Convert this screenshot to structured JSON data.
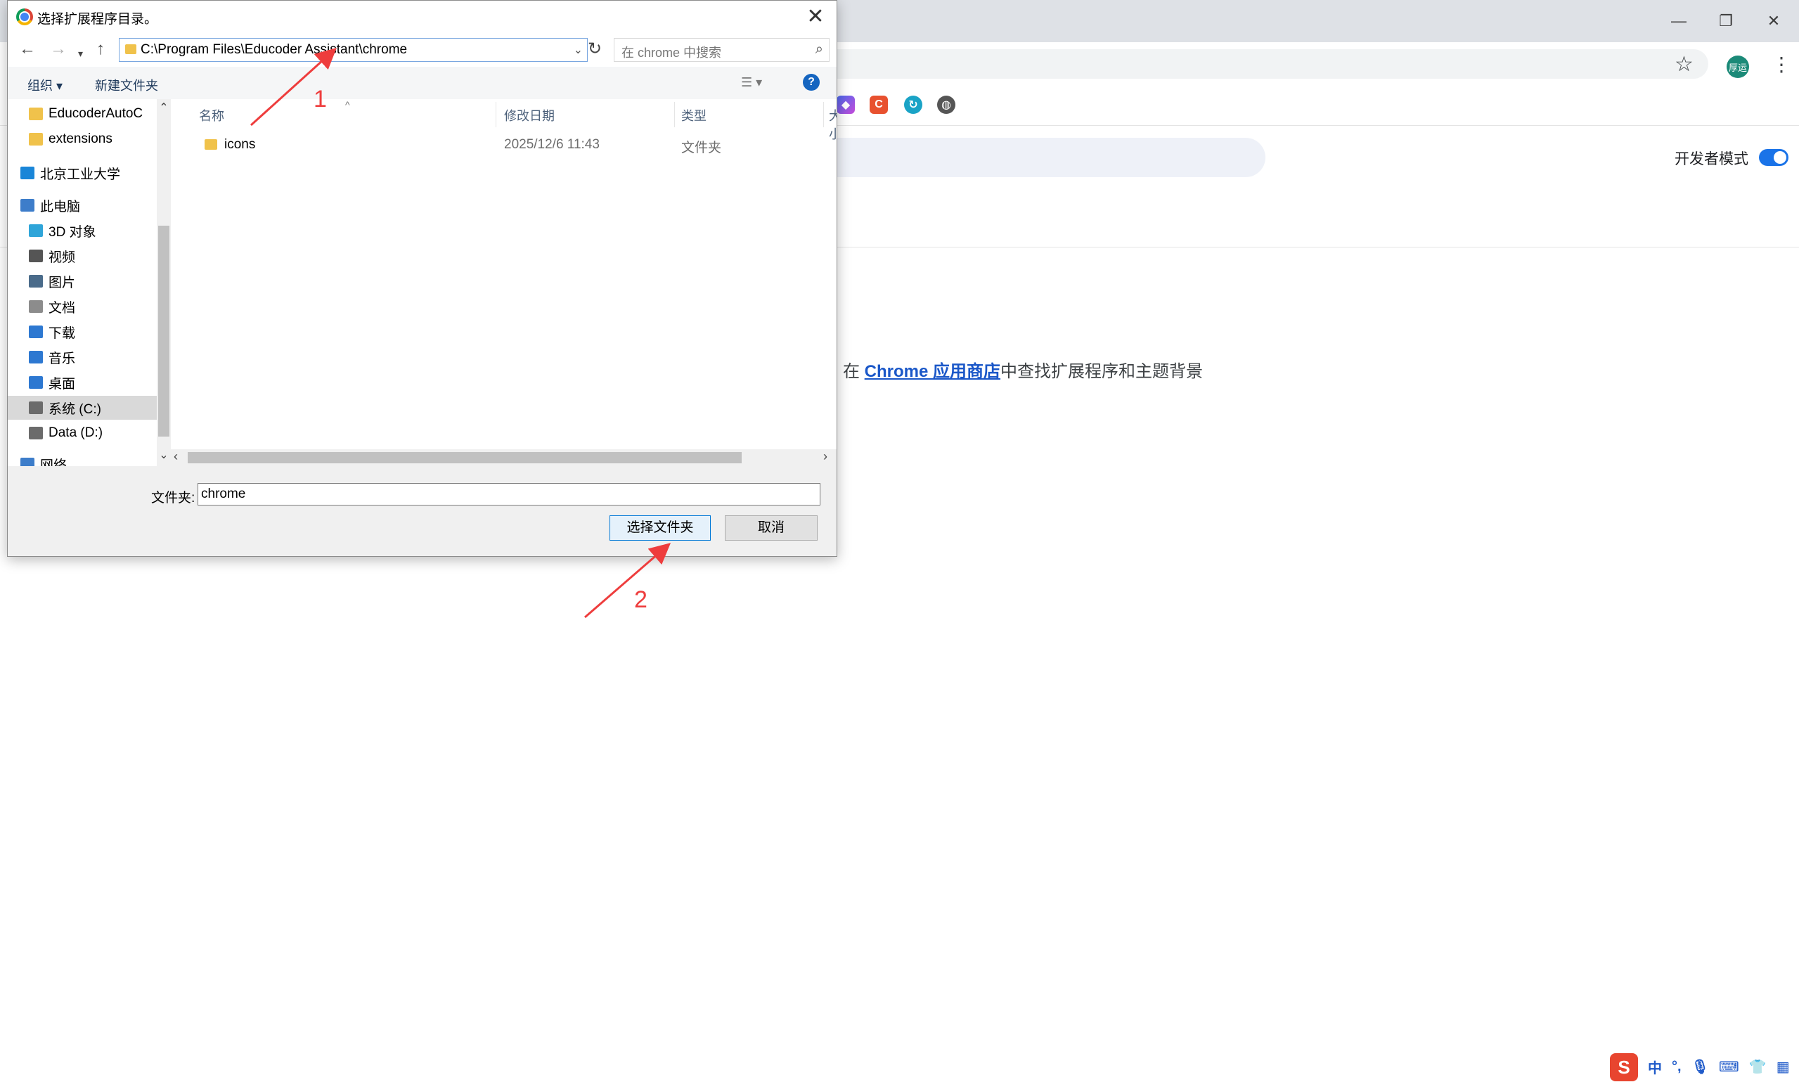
{
  "browser": {
    "window_controls": {
      "minimize": "—",
      "restore": "❐",
      "close": "✕"
    },
    "avatar_text": "厚运",
    "developer_mode_label": "开发者模式",
    "store_line": {
      "prefix": "在 ",
      "link": "Chrome 应用商店",
      "suffix": "中查找扩展程序和主题背景"
    }
  },
  "dialog": {
    "title": "选择扩展程序目录。",
    "address_path": "C:\\Program Files\\Educoder Assistant\\chrome",
    "search_placeholder": "在 chrome 中搜索",
    "toolbar": {
      "organize": "组织 ▾",
      "new_folder": "新建文件夹"
    },
    "nav_tree": [
      {
        "label": "EducoderAutoC",
        "icon": "folder-icon"
      },
      {
        "label": "extensions",
        "icon": "folder-icon"
      },
      {
        "label": "北京工业大学",
        "icon": "onedrive-icon"
      },
      {
        "label": "此电脑",
        "icon": "computer-icon"
      },
      {
        "label": "3D 对象",
        "icon": "3d-objects-icon"
      },
      {
        "label": "视频",
        "icon": "video-icon"
      },
      {
        "label": "图片",
        "icon": "pictures-icon"
      },
      {
        "label": "文档",
        "icon": "documents-icon"
      },
      {
        "label": "下载",
        "icon": "download-icon"
      },
      {
        "label": "音乐",
        "icon": "music-icon"
      },
      {
        "label": "桌面",
        "icon": "desktop-icon"
      },
      {
        "label": "系统 (C:)",
        "icon": "drive-icon"
      },
      {
        "label": "Data (D:)",
        "icon": "drive-icon"
      },
      {
        "label": "网络",
        "icon": "network-icon"
      }
    ],
    "columns": [
      "名称",
      "修改日期",
      "类型",
      "大小"
    ],
    "files": [
      {
        "name": "icons",
        "modified": "2025/12/6 11:43",
        "type": "文件夹"
      }
    ],
    "folder_label": "文件夹:",
    "folder_value": "chrome",
    "select_button": "选择文件夹",
    "cancel_button": "取消"
  },
  "annotations": {
    "arrow1": "1",
    "arrow2": "2"
  },
  "ime": {
    "lang": "中",
    "punct": "°,",
    "items": [
      "mic-icon",
      "keyboard-icon",
      "skin-icon",
      "toolbox-icon"
    ]
  },
  "colors": {
    "accent": "#1a73e8",
    "annotation": "#ee3d3d",
    "dialog_footer": "#f0f0f0"
  }
}
